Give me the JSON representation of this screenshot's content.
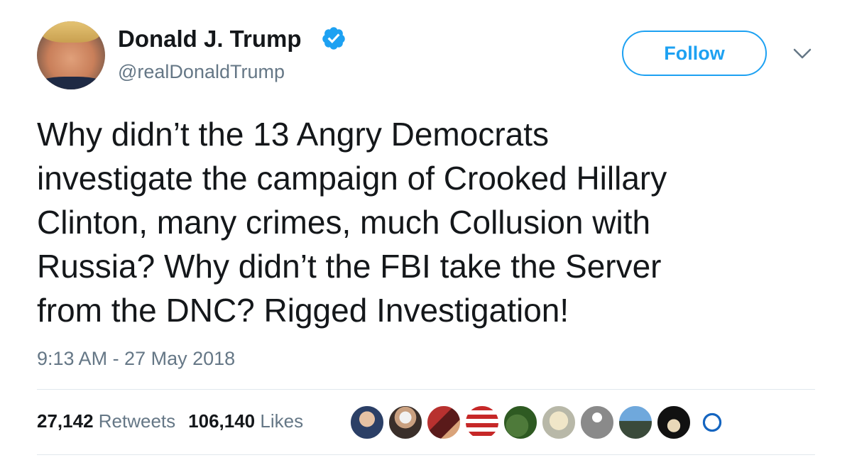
{
  "author": {
    "display_name": "Donald J. Trump",
    "handle": "@realDonaldTrump",
    "verified": true
  },
  "follow_button": {
    "label": "Follow"
  },
  "tweet": {
    "text": "Why didn’t the 13 Angry Democrats\ninvestigate the campaign of Crooked Hillary\nClinton, many crimes, much Collusion with\nRussia? Why didn’t the FBI take the Server\nfrom the DNC?  Rigged Investigation!",
    "timestamp": "9:13 AM - 27 May 2018"
  },
  "stats": {
    "retweets_count": "27,142",
    "retweets_label": "Retweets",
    "likes_count": "106,140",
    "likes_label": "Likes"
  },
  "likers_count_shown": 10,
  "colors": {
    "accent": "#1da1f2",
    "secondary_text": "#657786",
    "primary_text": "#14171a",
    "divider": "#e1e8ed"
  },
  "icons": {
    "verified": "verified-badge-icon",
    "menu": "chevron-down-icon"
  }
}
